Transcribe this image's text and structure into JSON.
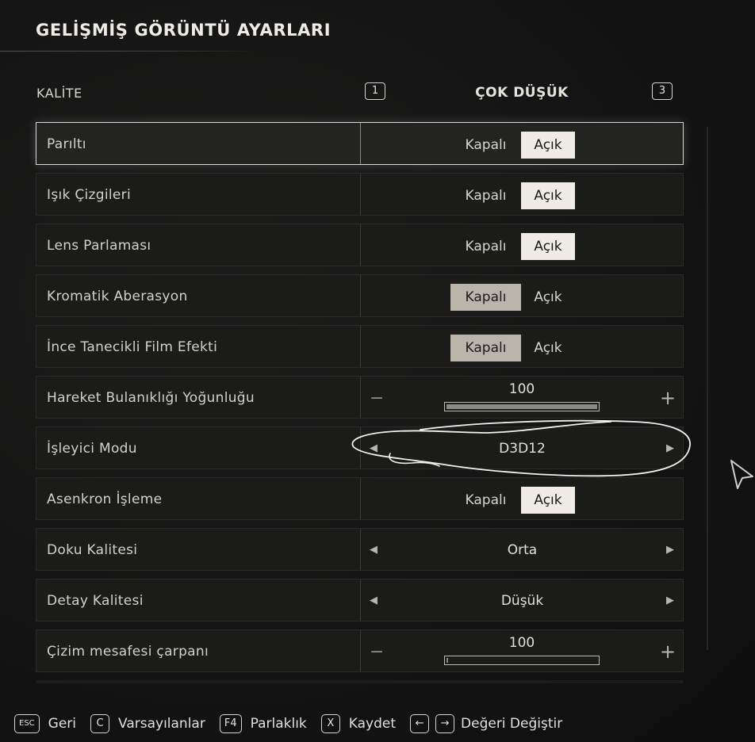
{
  "page": {
    "title": "GELİŞMİŞ GÖRÜNTÜ AYARLARI"
  },
  "quality": {
    "label": "KALİTE",
    "value": "ÇOK DÜŞÜK",
    "prev_key": "1",
    "next_key": "3"
  },
  "settings": [
    {
      "label": "Parıltı",
      "type": "toggle",
      "off_label": "Kapalı",
      "on_label": "Açık",
      "state": "on",
      "selected": true
    },
    {
      "label": "Işık Çizgileri",
      "type": "toggle",
      "off_label": "Kapalı",
      "on_label": "Açık",
      "state": "on"
    },
    {
      "label": "Lens Parlaması",
      "type": "toggle",
      "off_label": "Kapalı",
      "on_label": "Açık",
      "state": "on"
    },
    {
      "label": "Kromatik Aberasyon",
      "type": "toggle",
      "off_label": "Kapalı",
      "on_label": "Açık",
      "state": "off"
    },
    {
      "label": "İnce Tanecikli Film Efekti",
      "type": "toggle",
      "off_label": "Kapalı",
      "on_label": "Açık",
      "state": "off"
    },
    {
      "label": "Hareket Bulanıklığı Yoğunluğu",
      "type": "slider",
      "value": "100",
      "fill_fraction": 1.0
    },
    {
      "label": "İşleyici Modu",
      "type": "selector",
      "value": "D3D12"
    },
    {
      "label": "Asenkron İşleme",
      "type": "toggle",
      "off_label": "Kapalı",
      "on_label": "Açık",
      "state": "on"
    },
    {
      "label": "Doku Kalitesi",
      "type": "selector",
      "value": "Orta"
    },
    {
      "label": "Detay Kalitesi",
      "type": "selector",
      "value": "Düşük"
    },
    {
      "label": "Çizim mesafesi çarpanı",
      "type": "slider",
      "value": "100",
      "fill_fraction": 0.0
    }
  ],
  "footer": {
    "back": {
      "key": "ESC",
      "label": "Geri"
    },
    "defaults": {
      "key": "C",
      "label": "Varsayılanlar"
    },
    "brightness": {
      "key": "F4",
      "label": "Parlaklık"
    },
    "save": {
      "key": "X",
      "label": "Kaydet"
    },
    "change": {
      "key_left": "←",
      "key_right": "→",
      "label": "Değeri Değiştir"
    }
  },
  "icons": {
    "selector_prev": "chevron-left-icon",
    "selector_next": "chevron-right-icon",
    "slider_minus": "minus-icon",
    "slider_plus": "plus-icon",
    "cursor": "mouse-pointer-icon"
  },
  "colors": {
    "background": "#141414",
    "row_background": "#1b1b1a",
    "toggle_active": "#efece4",
    "toggle_off_active": "#b9b5ab",
    "text": "#e6e3dc"
  }
}
